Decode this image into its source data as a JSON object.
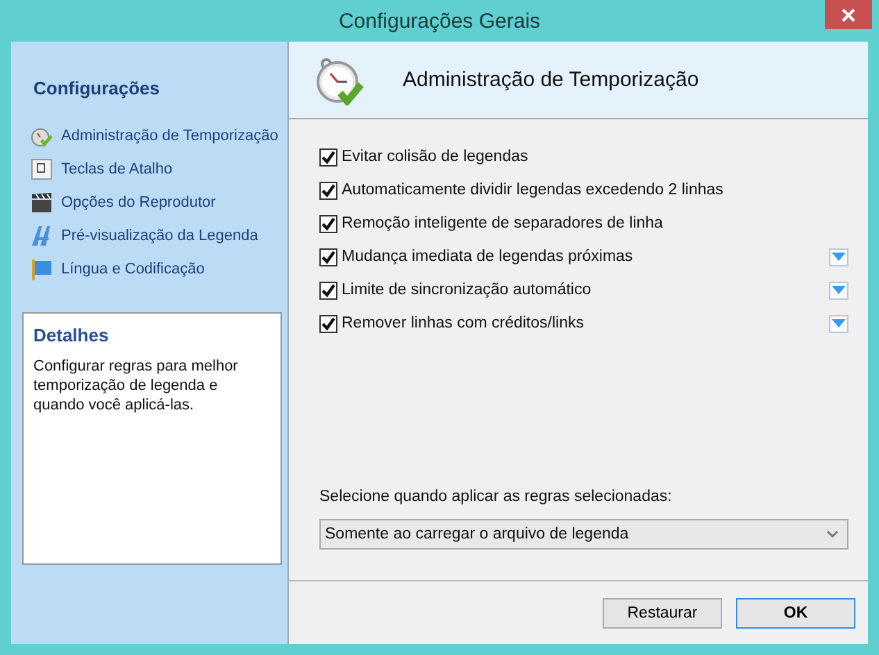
{
  "window": {
    "title": "Configurações Gerais"
  },
  "sidebar": {
    "title": "Configurações",
    "items": [
      {
        "label": "Administração de Temporização",
        "kind": "stopwatch"
      },
      {
        "label": "Teclas de Atalho",
        "kind": "key"
      },
      {
        "label": "Opções do Reprodutor",
        "kind": "clapper"
      },
      {
        "label": "Pré-visualização da Legenda",
        "kind": "letters"
      },
      {
        "label": "Língua e Codificação",
        "kind": "flag"
      }
    ],
    "details": {
      "title": "Detalhes",
      "text": "Configurar regras para melhor temporização de legenda e quando você aplicá-las."
    }
  },
  "panel": {
    "title": "Administração de Temporização",
    "options": [
      {
        "label": "Evitar colisão de legendas",
        "checked": true,
        "menu": false
      },
      {
        "label": "Automaticamente dividir legendas excedendo 2 linhas",
        "checked": true,
        "menu": false
      },
      {
        "label": "Remoção inteligente de separadores de linha",
        "checked": true,
        "menu": false
      },
      {
        "label": "Mudança imediata de legendas próximas",
        "checked": true,
        "menu": true
      },
      {
        "label": "Limite de sincronização automático",
        "checked": true,
        "menu": true
      },
      {
        "label": "Remover linhas com créditos/links",
        "checked": true,
        "menu": true
      }
    ],
    "apply_label": "Selecione quando aplicar as regras selecionadas:",
    "apply_value": "Somente ao carregar o arquivo de legenda"
  },
  "buttons": [
    {
      "label": "Restaurar",
      "default": false
    },
    {
      "label": "OK",
      "default": true
    }
  ]
}
